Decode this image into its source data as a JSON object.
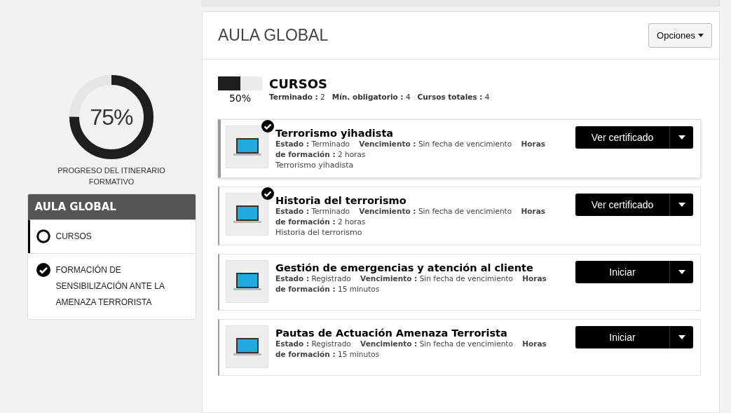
{
  "progress": {
    "level": 0.75,
    "value": "75%",
    "caption": "PROGRESO DEL ITINERARIO FORMATIVO"
  },
  "sidebar": {
    "title": "AULA GLOBAL",
    "items": [
      {
        "label": "CURSOS",
        "selected": true,
        "completed": false
      },
      {
        "label": "FORMACIÓN DE SENSIBILIZACIÓN ANTE LA AMENAZA TERRORISTA",
        "selected": false,
        "completed": true
      }
    ]
  },
  "page": {
    "title": "AULA GLOBAL",
    "options_button": "Opciones"
  },
  "section": {
    "title": "CURSOS",
    "level": 0.5,
    "percent": "50%",
    "stats": "**Terminado :** 2   **Mín. obligatorio :** 4   **Cursos totales :** 4"
  },
  "courses": [
    {
      "title": "Terrorismo yihadista",
      "completed": true,
      "selected": true,
      "details": "**Estado :** Terminado    **Vencimiento :** Sin fecha de vencimiento    **Horas de formación :** 2 horas",
      "description": "Terrorismo yihadista",
      "action": "Ver certificado"
    },
    {
      "title": "Historia del terrorismo",
      "completed": true,
      "selected": false,
      "details": "**Estado :** Terminado    **Vencimiento :** Sin fecha de vencimiento    **Horas de formación :** 2 horas",
      "description": "Historia del terrorismo",
      "action": "Ver certificado"
    },
    {
      "title": "Gestión de emergencias y atención al cliente",
      "completed": false,
      "selected": false,
      "details": "**Estado :** Registrado    **Vencimiento :** Sin fecha de vencimiento    **Horas de formación :** 15 minutos",
      "action": "Iniciar"
    },
    {
      "title": "Pautas de Actuación Amenaza Terrorista",
      "completed": false,
      "selected": false,
      "details": "**Estado :** Registrado    **Vencimiento :** Sin fecha de vencimiento    **Horas de formación :** 15 minutos",
      "action": "Iniciar"
    }
  ]
}
